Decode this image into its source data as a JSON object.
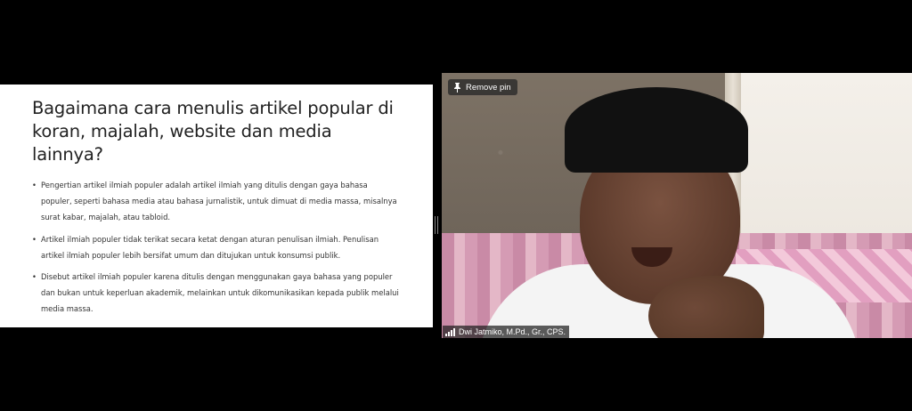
{
  "slide": {
    "title": "Bagaimana cara menulis artikel popular di koran, majalah, website dan media lainnya?",
    "bullets": [
      "Pengertian artikel ilmiah populer adalah artikel ilmiah yang ditulis dengan gaya bahasa populer, seperti bahasa media atau bahasa jurnalistik, untuk dimuat di media massa, misalnya surat kabar, majalah, atau tabloid.",
      "Artikel ilmiah populer tidak terikat secara ketat dengan aturan penulisan ilmiah. Penulisan artikel ilmiah populer lebih bersifat umum dan ditujukan untuk konsumsi publik.",
      "Disebut artikel ilmiah populer karena ditulis dengan menggunakan gaya bahasa yang populer dan bukan untuk keperluan akademik, melainkan untuk dikomunikasikan kepada publik melalui media massa."
    ]
  },
  "video": {
    "pin_button_label": "Remove pin",
    "pin_icon": "pin-icon",
    "participant_name": "Dwi Jatmiko, M.Pd., Gr., CPS.",
    "signal_icon": "signal-strength-icon"
  },
  "colors": {
    "background": "#000000",
    "slide_background": "#ffffff",
    "overlay": "#282828"
  }
}
